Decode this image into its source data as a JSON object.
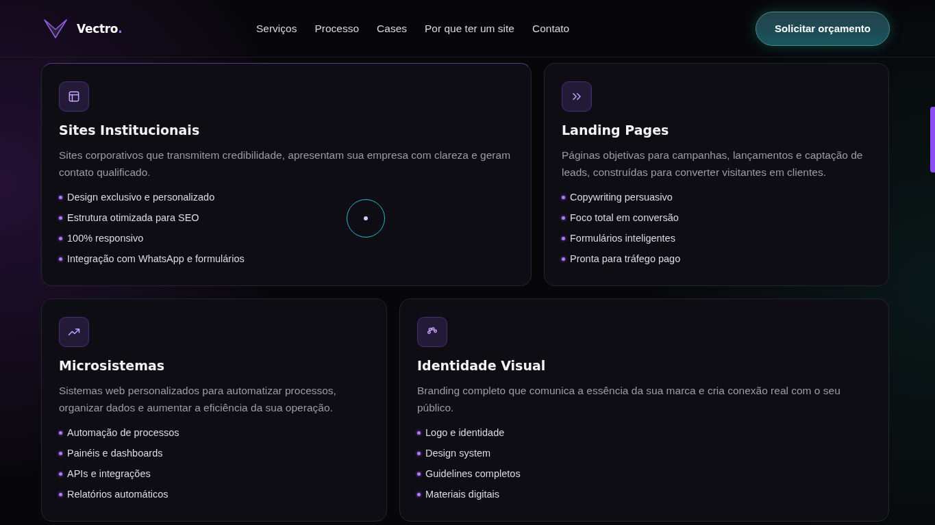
{
  "header": {
    "brand": "Vectro",
    "brand_dot": ".",
    "nav": [
      {
        "label": "Serviços"
      },
      {
        "label": "Processo"
      },
      {
        "label": "Cases"
      },
      {
        "label": "Por que ter um site"
      },
      {
        "label": "Contato"
      }
    ],
    "cta": "Solicitar orçamento"
  },
  "rows": [
    {
      "cards": [
        {
          "title": "Sites Institucionais",
          "description": "Sites corporativos que transmitem credibilidade, apresentam sua empresa com clareza e geram contato qualificado.",
          "features": [
            "Design exclusivo e personalizado",
            "Estrutura otimizada para SEO",
            "100% responsivo",
            "Integração com WhatsApp e formulários"
          ]
        },
        {
          "title": "Landing Pages",
          "description": "Páginas objetivas para campanhas, lançamentos e captação de leads, construídas para converter visitantes em clientes.",
          "features": [
            "Copywriting persuasivo",
            "Foco total em conversão",
            "Formulários inteligentes",
            "Pronta para tráfego pago"
          ]
        }
      ]
    },
    {
      "cards": [
        {
          "title": "Microsistemas",
          "description": "Sistemas web personalizados para automatizar processos, organizar dados e aumentar a eficiência da sua operação.",
          "features": [
            "Automação de processos",
            "Painéis e dashboards",
            "APIs e integrações",
            "Relatórios automáticos"
          ]
        },
        {
          "title": "Identidade Visual",
          "description": "Branding completo que comunica a essência da sua marca e cria conexão real com o seu público.",
          "features": [
            "Logo e identidade",
            "Design system",
            "Guidelines completos",
            "Materiais digitais"
          ]
        }
      ]
    }
  ]
}
